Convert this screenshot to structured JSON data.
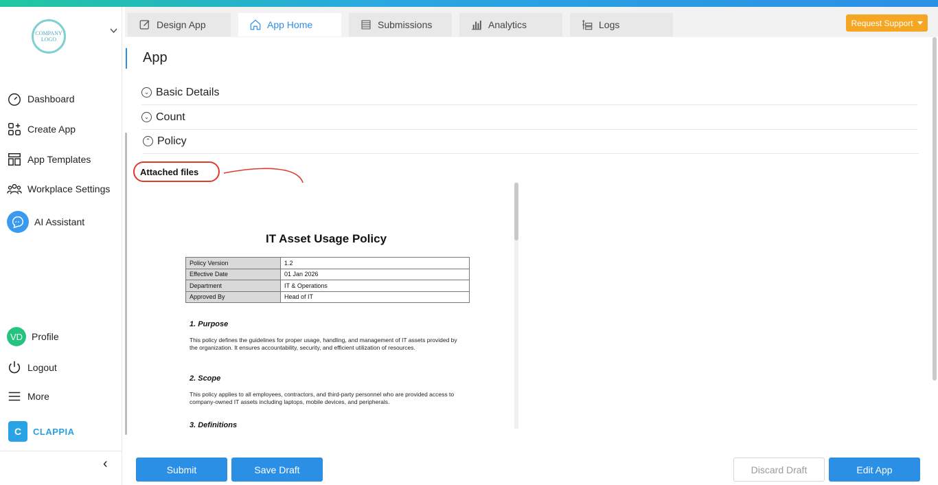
{
  "logo": {
    "text_line1": "COMPANY",
    "text_line2": "LOGO"
  },
  "sidebar": {
    "items": [
      {
        "label": "Dashboard",
        "icon": "speedometer-icon"
      },
      {
        "label": "Create App",
        "icon": "grid-plus-icon"
      },
      {
        "label": "App Templates",
        "icon": "template-icon"
      },
      {
        "label": "Workplace Settings",
        "icon": "users-gear-icon"
      },
      {
        "label": "AI Assistant",
        "icon": "ai-chat-icon"
      }
    ],
    "profile": {
      "initials": "VD",
      "label": "Profile"
    },
    "logout": "Logout",
    "more": "More",
    "brand": "CLAPPIA",
    "brand_mark": "C",
    "collapse": "‹"
  },
  "tabs": [
    {
      "label": "Design App",
      "icon": "edit-icon",
      "active": false
    },
    {
      "label": "App Home",
      "icon": "home-icon",
      "active": true
    },
    {
      "label": "Submissions",
      "icon": "list-icon",
      "active": false
    },
    {
      "label": "Analytics",
      "icon": "bar-chart-icon",
      "active": false
    },
    {
      "label": "Logs",
      "icon": "logs-icon",
      "active": false
    }
  ],
  "support_button": "Request Support",
  "page_title": "App",
  "sections": [
    {
      "label": "Basic Details",
      "expanded": false
    },
    {
      "label": "Count",
      "expanded": false
    },
    {
      "label": "Policy",
      "expanded": true
    }
  ],
  "attached_files_label": "Attached files",
  "annotation_color": "#e03a2d",
  "document": {
    "title": "IT Asset Usage Policy",
    "meta": [
      {
        "key": "Policy Version",
        "value": "1.2"
      },
      {
        "key": "Effective Date",
        "value": "01 Jan 2026"
      },
      {
        "key": "Department",
        "value": "IT & Operations"
      },
      {
        "key": "Approved By",
        "value": "Head of IT"
      }
    ],
    "h1": "1. Purpose",
    "p1": "This policy defines the guidelines for proper usage, handling, and management of IT assets provided by the organization. It ensures accountability, security, and efficient utilization of resources.",
    "h2": "2. Scope",
    "p2": "This policy applies to all employees, contractors, and third-party personnel who are provided access to company-owned IT assets including laptops, mobile devices, and peripherals.",
    "h3": "3. Definitions"
  },
  "buttons": {
    "submit": "Submit",
    "save_draft": "Save Draft",
    "discard_draft": "Discard Draft",
    "edit_app": "Edit App"
  },
  "colors": {
    "accent": "#2b8fe6",
    "support": "#f5a623",
    "avatar": "#22c47f"
  }
}
